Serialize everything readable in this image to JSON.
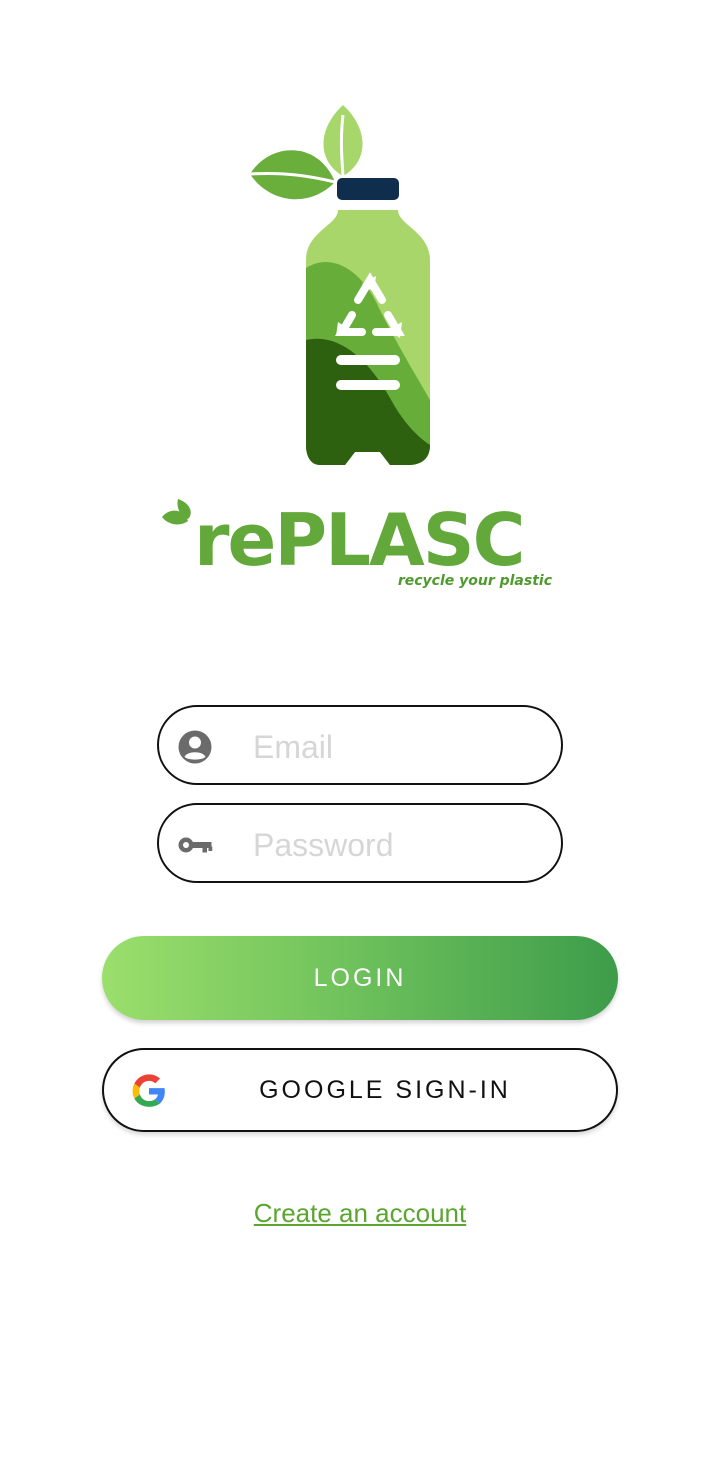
{
  "brand": {
    "name": "rePLASC",
    "tagline": "recycle your plastic",
    "colors": {
      "primary": "#62a83a",
      "dark": "#2d6110",
      "cap": "#0f2d4d"
    }
  },
  "login_form": {
    "email": {
      "placeholder": "Email",
      "value": "",
      "icon": "account-circle-icon"
    },
    "password": {
      "placeholder": "Password",
      "value": "",
      "icon": "key-icon"
    }
  },
  "buttons": {
    "login_label": "LOGIN",
    "google_label": "GOOGLE SIGN-IN",
    "google_icon": "google-g-icon"
  },
  "links": {
    "create_account": "Create an account"
  }
}
